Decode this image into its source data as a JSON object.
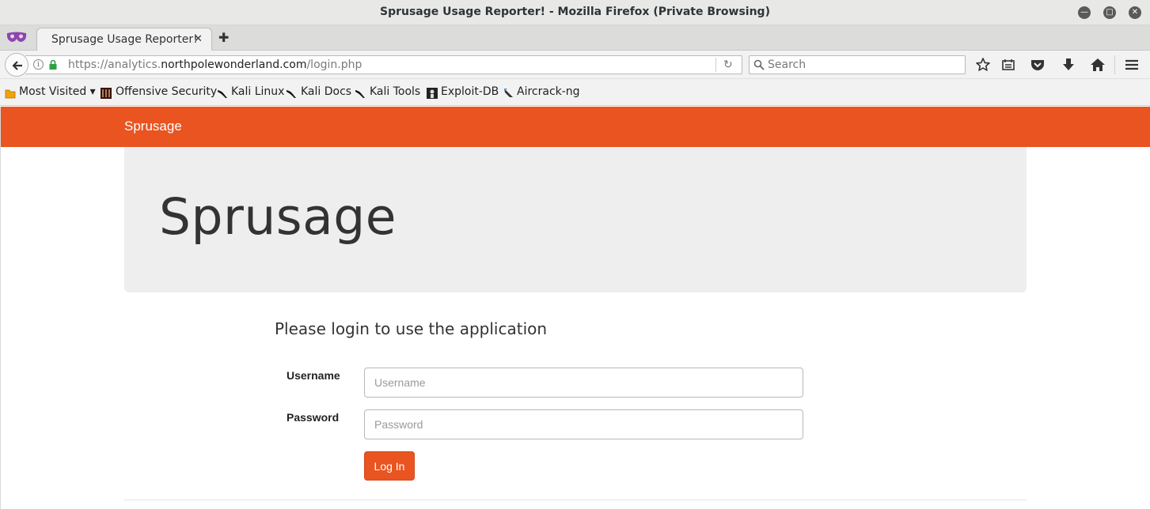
{
  "window": {
    "title": "Sprusage Usage Reporter! - Mozilla Firefox (Private Browsing)"
  },
  "tabs": [
    {
      "label": "Sprusage Usage Reporter!",
      "active": true
    }
  ],
  "urlbar": {
    "prefix": "https://analytics.",
    "host": "northpolewonderland.com",
    "path": "/login.php"
  },
  "search": {
    "placeholder": "Search"
  },
  "bookmarks": [
    {
      "label": "Most Visited ▾",
      "icon": "folder-icon"
    },
    {
      "label": "Offensive Security",
      "icon": "offsec-icon"
    },
    {
      "label": "Kali Linux",
      "icon": "kali-dragon-icon"
    },
    {
      "label": "Kali Docs",
      "icon": "kali-dragon-icon"
    },
    {
      "label": "Kali Tools",
      "icon": "kali-dragon-icon"
    },
    {
      "label": "Exploit-DB",
      "icon": "exploitdb-icon"
    },
    {
      "label": "Aircrack-ng",
      "icon": "aircrack-icon"
    }
  ],
  "app": {
    "brand": "Sprusage",
    "jumbotron_title": "Sprusage",
    "login_heading": "Please login to use the application",
    "username_label": "Username",
    "username_placeholder": "Username",
    "password_label": "Password",
    "password_placeholder": "Password",
    "login_button": "Log In"
  },
  "colors": {
    "accent": "#e95420",
    "jumbotron_bg": "#eeeeee"
  }
}
